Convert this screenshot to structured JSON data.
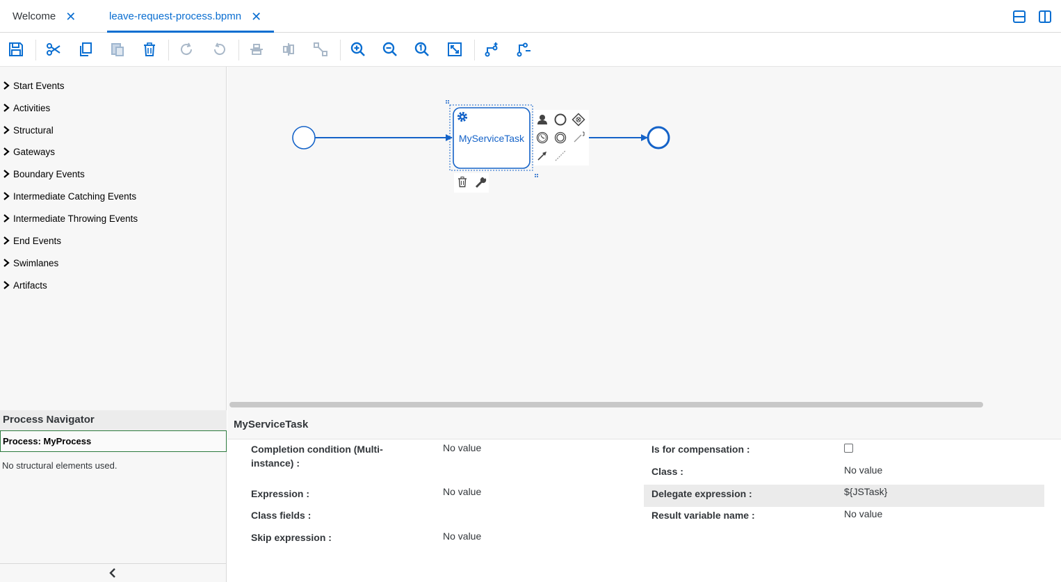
{
  "tabs": [
    {
      "label": "Welcome",
      "active": false
    },
    {
      "label": "leave-request-process.bpmn",
      "active": true
    }
  ],
  "toolbar": {
    "buttons": [
      "save-icon",
      "cut-icon",
      "copy-icon",
      "paste-icon",
      "delete-icon",
      "redo-icon",
      "undo-icon",
      "align-horizontal-icon",
      "align-vertical-icon",
      "distribute-icon",
      "zoom-in-icon",
      "zoom-out-icon",
      "zoom-reset-icon",
      "fit-to-window-icon",
      "add-connection-icon",
      "route-connection-icon"
    ]
  },
  "palette": {
    "items": [
      {
        "label": "Start Events"
      },
      {
        "label": "Activities"
      },
      {
        "label": "Structural"
      },
      {
        "label": "Gateways"
      },
      {
        "label": "Boundary Events"
      },
      {
        "label": "Intermediate Catching Events"
      },
      {
        "label": "Intermediate Throwing Events"
      },
      {
        "label": "End Events"
      },
      {
        "label": "Swimlanes"
      },
      {
        "label": "Artifacts"
      }
    ]
  },
  "diagram": {
    "task_label": "MyServiceTask"
  },
  "navigator": {
    "title": "Process Navigator",
    "process_label": "Process: MyProcess",
    "empty_message": "No structural elements used."
  },
  "properties": {
    "title": "MyServiceTask",
    "left": [
      {
        "label": "Completion condition (Multi-",
        "label2": "instance) :",
        "value": "No value"
      },
      {
        "label": "Expression :",
        "value": "No value"
      },
      {
        "label": "Class fields :",
        "value": ""
      },
      {
        "label": "Skip expression :",
        "value": "No value"
      }
    ],
    "right": [
      {
        "label": "Is for compensation :",
        "value": ""
      },
      {
        "label": "Class :",
        "value": "No value"
      },
      {
        "label": "Delegate expression :",
        "value": "${JSTask}"
      },
      {
        "label": "Result variable name :",
        "value": "No value"
      }
    ]
  },
  "colors": {
    "accent": "#0a6ed1",
    "bpmn": "#1563c8"
  }
}
